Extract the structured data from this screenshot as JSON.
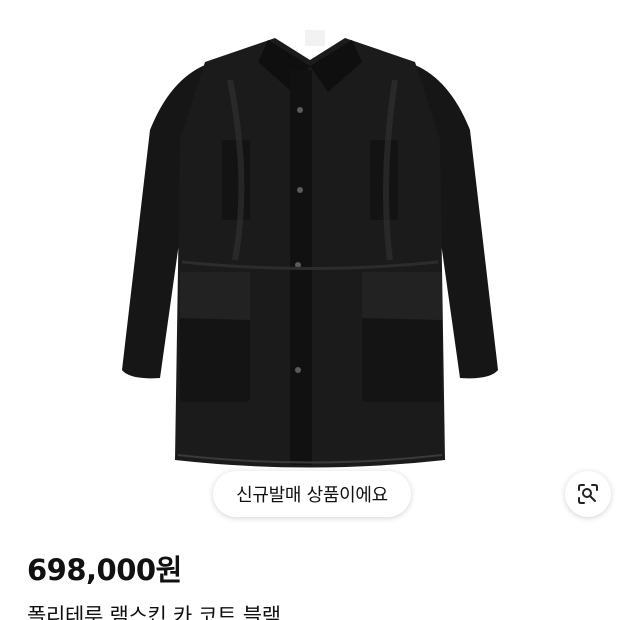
{
  "product": {
    "image_alt": "black leather coat",
    "badge_label": "신규발매 상품이에요",
    "price": "698,000원",
    "title": "폴리테루 램스킨 카 코트 블랙"
  },
  "icons": {
    "lens": "lens-search-icon"
  },
  "colors": {
    "text": "#111111",
    "background": "#ffffff",
    "coat": "#151515"
  }
}
